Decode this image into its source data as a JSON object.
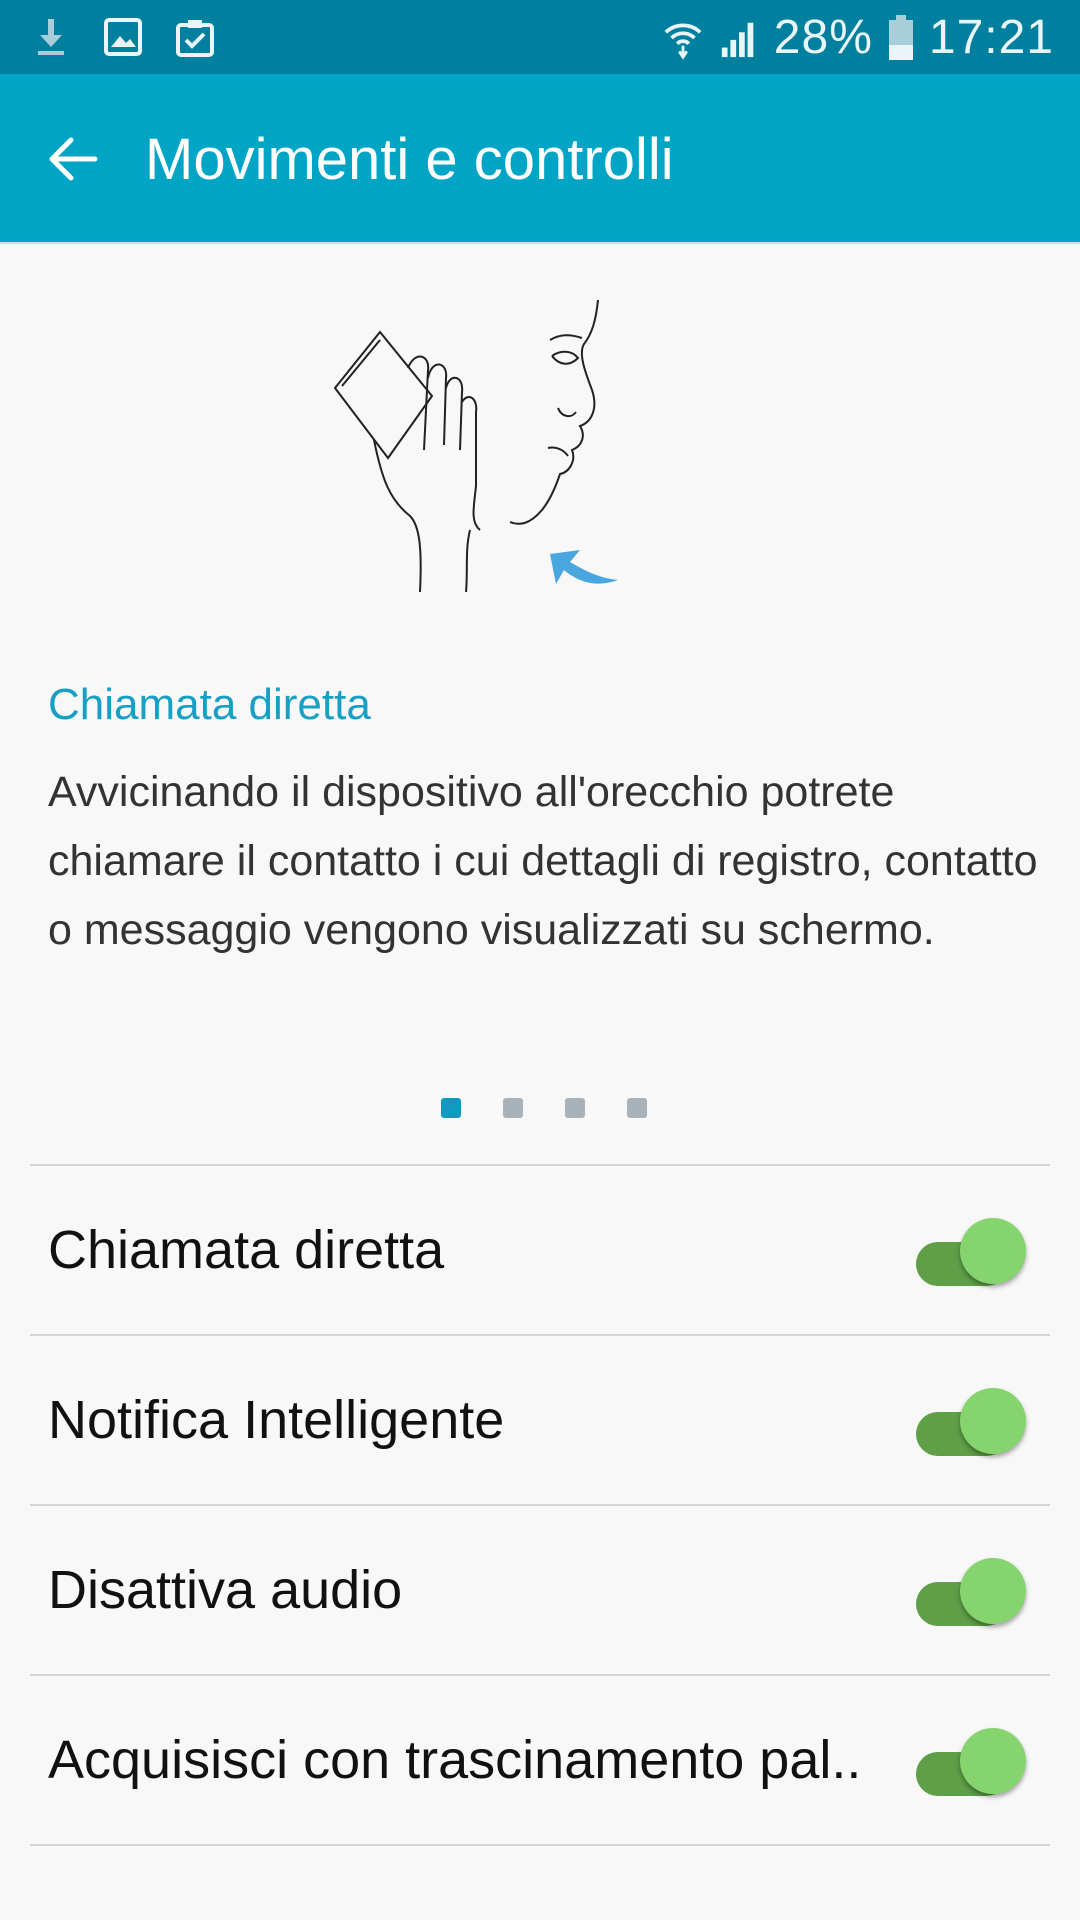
{
  "status_bar": {
    "icons_left": [
      "download-icon",
      "image-icon",
      "clipboard-check-icon"
    ],
    "icons_right": [
      "wifi-icon",
      "signal-icon",
      "battery-icon"
    ],
    "battery": "28%",
    "time": "17:21"
  },
  "app_bar": {
    "back_icon": "arrow-back-icon",
    "title": "Movimenti e controlli"
  },
  "tutorial": {
    "illustration": "hand-phone-to-ear-illustration",
    "title": "Chiamata diretta",
    "description": "Avvicinando il dispositivo all'orecchio potrete chiamare il contatto i cui dettagli di registro, contatto o messaggio vengono visualizzati su schermo.",
    "page_count": 4,
    "active_page": 1
  },
  "settings": [
    {
      "label": "Chiamata diretta",
      "enabled": true
    },
    {
      "label": "Notifica Intelligente",
      "enabled": true
    },
    {
      "label": "Disattiva audio",
      "enabled": true
    },
    {
      "label": "Acquisisci con trascinamento pal..",
      "enabled": true
    }
  ],
  "colors": {
    "status_bar": "#00809e",
    "app_bar": "#00a5c5",
    "accent": "#17a0c4",
    "toggle_on_track": "#5e9f48",
    "toggle_on_thumb": "#85d46e"
  }
}
